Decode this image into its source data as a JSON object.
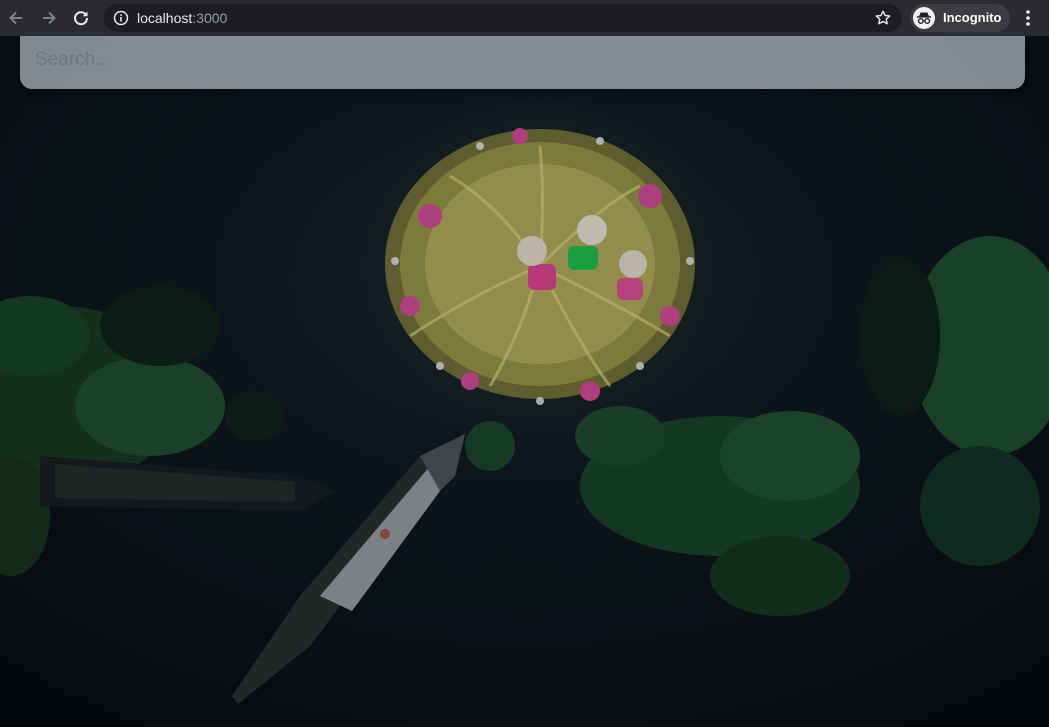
{
  "browser": {
    "url_host": "localhost",
    "url_port": ":3000",
    "profile_label": "Incognito",
    "icons": [
      "back-arrow-icon",
      "forward-arrow-icon",
      "reload-icon",
      "info-icon",
      "star-icon",
      "incognito-icon",
      "more-vert-icon"
    ]
  },
  "search": {
    "placeholder": "Search...",
    "value": ""
  },
  "colors": {
    "chrome_bg": "#2a2b2e",
    "omnibox_bg": "#1c1d20",
    "search_bar_bg": "#939ca0",
    "water": "#0c1216",
    "foliage": "#1f4a30"
  }
}
